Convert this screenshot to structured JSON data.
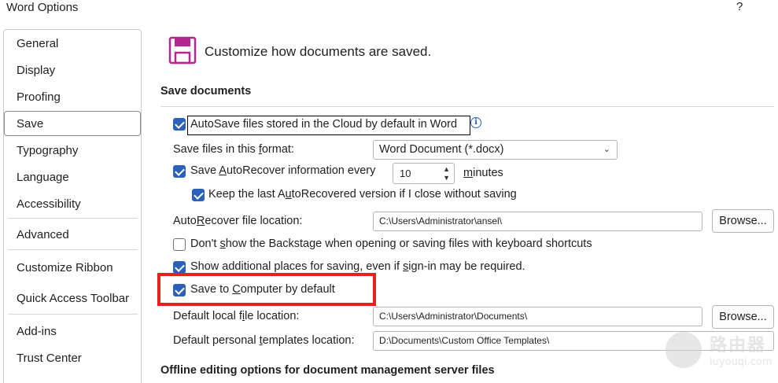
{
  "window": {
    "title": "Word Options",
    "help": "?"
  },
  "nav": {
    "items": [
      {
        "label": "General"
      },
      {
        "label": "Display"
      },
      {
        "label": "Proofing"
      },
      {
        "label": "Save",
        "selected": true
      },
      {
        "label": "Typography"
      },
      {
        "label": "Language"
      },
      {
        "label": "Accessibility"
      },
      {
        "label": "Advanced"
      },
      {
        "label": "Customize Ribbon"
      },
      {
        "label": "Quick Access Toolbar"
      },
      {
        "label": "Add-ins"
      },
      {
        "label": "Trust Center"
      }
    ]
  },
  "header": {
    "text": "Customize how documents are saved.",
    "icon": "floppy-disk-icon",
    "icon_color": "#b4278f"
  },
  "save_documents": {
    "title": "Save documents",
    "autosave": {
      "label": "AutoSave files stored in the Cloud by default in Word",
      "checked": true
    },
    "format": {
      "label_pre": "Save files in this ",
      "label_u": "f",
      "label_post": "ormat:",
      "value": "Word Document (*.docx)"
    },
    "autorecover": {
      "label_pre": "Save ",
      "label_u": "A",
      "label_post": "utoRecover information every",
      "checked": true,
      "minutes_value": "10",
      "minutes_u": "m",
      "minutes_rest": "inutes"
    },
    "keep_last": {
      "label_pre": "Keep the last A",
      "label_u": "u",
      "label_post": "toRecovered version if I close without saving",
      "checked": true
    },
    "autorecover_location": {
      "label_pre": "Auto",
      "label_u": "R",
      "label_post": "ecover file location:",
      "value": "C:\\Users\\Administrator\\ansel\\",
      "browse": "Browse..."
    },
    "backstage": {
      "label_pre": "Don't ",
      "label_u": "s",
      "label_post": "how the Backstage when opening or saving files with keyboard shortcuts",
      "checked": false
    },
    "additional_places": {
      "label_pre": "Show additional places for saving, even if ",
      "label_u": "s",
      "label_post": "ign-in may be required.",
      "checked": true
    },
    "computer_default": {
      "label_pre": "Save to ",
      "label_u": "C",
      "label_post": "omputer by default",
      "checked": true,
      "highlight_color": "#e8201c"
    },
    "default_local": {
      "label_pre": "Default local f",
      "label_u": "i",
      "label_post": "le location:",
      "value": "C:\\Users\\Administrator\\Documents\\",
      "browse": "Browse..."
    },
    "personal_templates": {
      "label_pre": "Default personal ",
      "label_u": "t",
      "label_post": "emplates location:",
      "value": "D:\\Documents\\Custom Office Templates\\"
    }
  },
  "offline": {
    "title": "Offline editing options for document management server files"
  },
  "watermark": {
    "name": "路由器",
    "url": "luyouqi.com"
  },
  "colors": {
    "accent": "#2b62b8",
    "highlight": "#e8201c"
  }
}
